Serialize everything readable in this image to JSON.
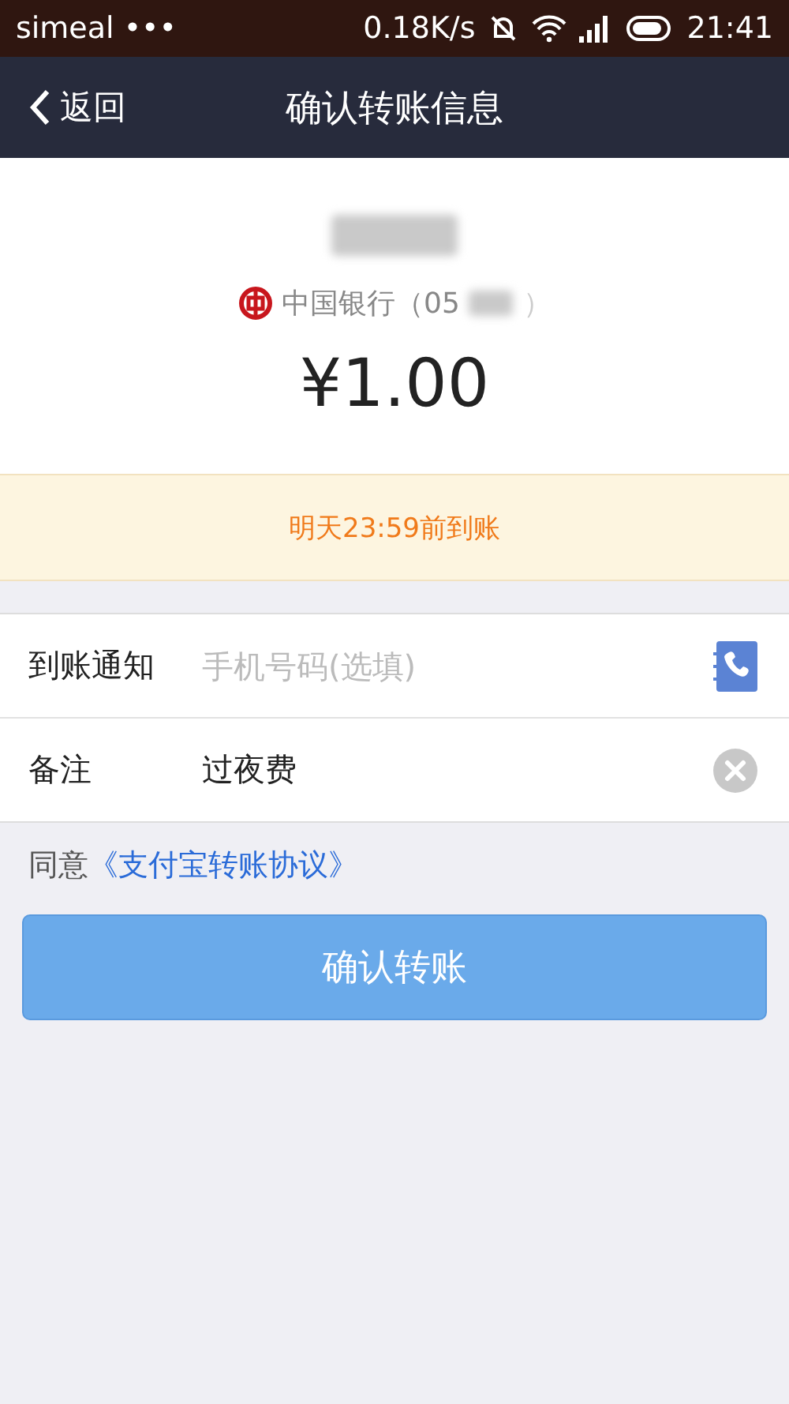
{
  "status_bar": {
    "carrier": "simeal •••",
    "speed": "0.18K/s",
    "time": "21:41"
  },
  "nav": {
    "back": "返回",
    "title": "确认转账信息"
  },
  "payee": {
    "bank": "中国银行（05",
    "bank_end": "）",
    "amount": "¥1.00"
  },
  "notice": "明天23:59前到账",
  "fields": [
    {
      "kind": "phone",
      "label": "到账通知",
      "placeholder": "手机号码(选填)"
    },
    {
      "kind": "clearable",
      "label": "备注",
      "value": "过夜费"
    }
  ],
  "agreement": {
    "text": "同意",
    "link": "《支付宝转账协议》"
  },
  "confirm_button": "确认转账"
}
